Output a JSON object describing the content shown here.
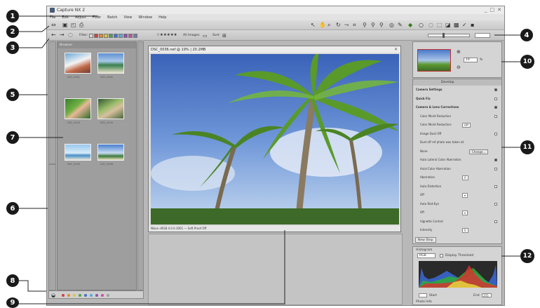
{
  "app": {
    "title": "Capture NX 2",
    "window_controls": [
      "_",
      "□",
      "✕"
    ],
    "menu": [
      "File",
      "Edit",
      "Adjust",
      "Filter",
      "Batch",
      "View",
      "Window",
      "Help"
    ]
  },
  "toolbar2": {
    "filter_label": "Filter:",
    "stars": "☆★★★★★",
    "images_label": "All Images",
    "sort_label": "Sort:"
  },
  "browser": {
    "title": "Browser",
    "thumbnails": [
      {
        "caption": "DSC_0001"
      },
      {
        "caption": "DSC_0002"
      },
      {
        "caption": "DSC_0003"
      },
      {
        "caption": "DSC_0004"
      },
      {
        "caption": "DSC_0005"
      },
      {
        "caption": "DSC_0006"
      }
    ]
  },
  "image_window": {
    "title": "DSC_0036.nef @ 19% | 20.2MB",
    "status": "Nikon sRGB 4.0.0.3001 — Soft Proof Off"
  },
  "birdseye": {
    "zoom_value": "19",
    "zoom_unit": "%"
  },
  "edit_list": {
    "header": "Develop",
    "items": [
      {
        "label": "Camera Settings",
        "checked": true
      },
      {
        "label": "Quick Fix",
        "checked": false
      },
      {
        "label": "Camera & Lens Corrections",
        "checked": true
      },
      {
        "label": "Color Moiré Reduction",
        "checked": false
      },
      {
        "label": "Color Moiré Reduction:",
        "value": "Off"
      },
      {
        "label": "Image Dust Off",
        "checked": false
      },
      {
        "label": "Dust off ref photo was taken at:"
      },
      {
        "label": "None",
        "button": "Change..."
      },
      {
        "label": "Auto Lateral Color Aberration",
        "checked": true
      },
      {
        "label": "Axial Color Aberration",
        "checked": false
      },
      {
        "label": "Aberration",
        "value": "0"
      },
      {
        "label": "Auto Distortion",
        "checked": false
      },
      {
        "label": "Off",
        "value": "▾"
      },
      {
        "label": "Auto Red-Eye",
        "checked": false
      },
      {
        "label": "Off",
        "value": "▾"
      },
      {
        "label": "Vignette Control",
        "checked": false
      },
      {
        "label": "Intensity",
        "value": "0"
      }
    ],
    "new_step": "New Step"
  },
  "histogram": {
    "title": "Histogram",
    "channel": "RGB",
    "threshold_label": "Display Threshold",
    "start_label": "Start",
    "end_label": "End",
    "end_value": "255",
    "footer": "Photo Info"
  },
  "callouts": [
    "1",
    "2",
    "3",
    "4",
    "5",
    "6",
    "7",
    "8",
    "9",
    "10",
    "11",
    "12"
  ]
}
